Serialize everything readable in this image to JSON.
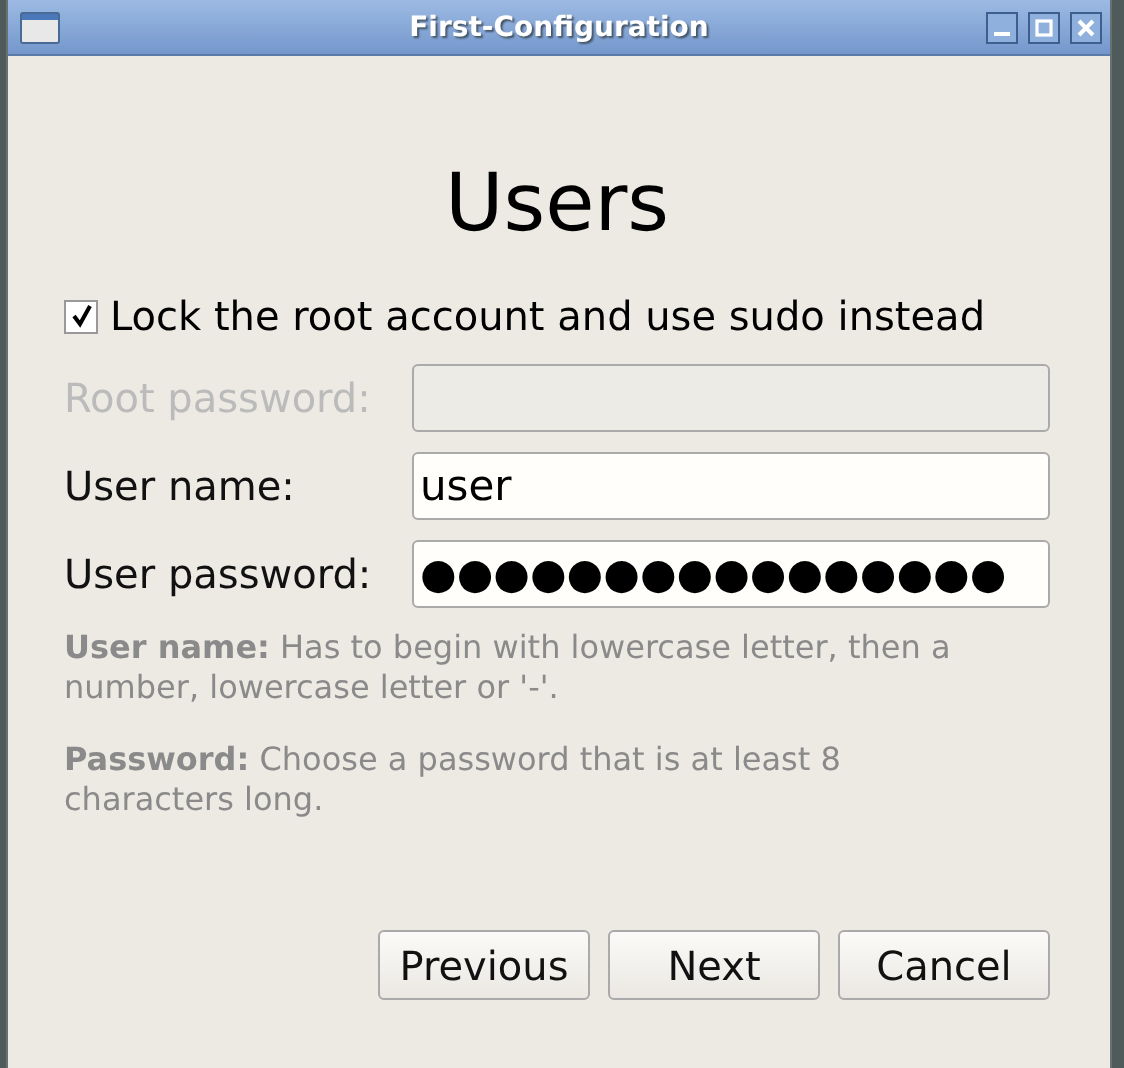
{
  "window": {
    "title": "First-Configuration"
  },
  "heading": "Users",
  "lock_root": {
    "label": "Lock the root account and use sudo instead",
    "checked": true
  },
  "fields": [
    {
      "label": "Root password:",
      "disabled": true
    },
    {
      "label": "User name:",
      "value": "user",
      "disabled": false
    },
    {
      "label": "User password:",
      "value": "●●●●●●●●●●●●●●●●",
      "disabled": false
    }
  ],
  "hints": [
    "**User name:** Has to begin with lowercase letter, then a number, lowercase letter or '-'.",
    "**Password:** Choose a password that is at least 8 characters long."
  ],
  "buttons": [
    "Previous",
    "Next",
    "Cancel"
  ]
}
